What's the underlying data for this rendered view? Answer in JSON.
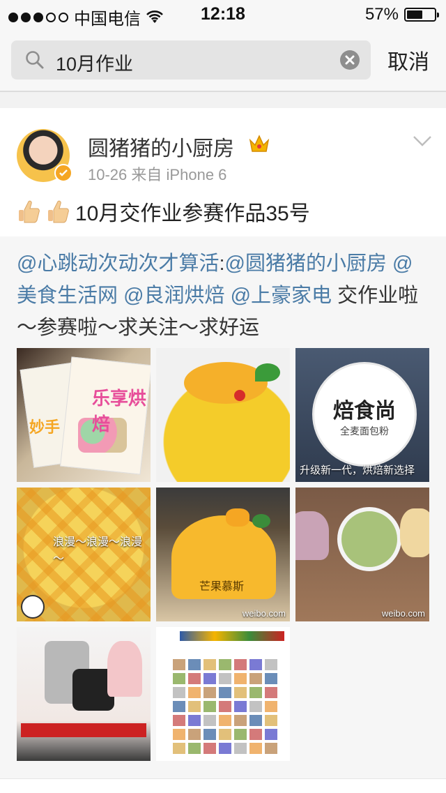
{
  "status_bar": {
    "carrier": "中国电信",
    "time": "12:18",
    "battery_percent": "57%",
    "battery_level": 0.57,
    "signal_bars": 3
  },
  "search": {
    "query": "10月作业",
    "cancel_label": "取消",
    "icons": {
      "search": "search-icon",
      "clear": "clear-icon"
    }
  },
  "post": {
    "username": "圆猪猪的小厨房",
    "time": "10-26",
    "source_prefix": "来自",
    "source": "iPhone 6",
    "text": "10月交作业参赛作品35号",
    "icons": {
      "verified": "verified-badge",
      "crown": "crown-icon",
      "menu": "chevron-down-icon",
      "emoji": "thumbs-up-icon"
    }
  },
  "repost": {
    "mention_1": "@心跳动次动次才算活",
    "colon": ":",
    "mention_2": "@圆猪猪的小厨房",
    "mention_3": "@美食生活网",
    "mention_4": "@良润烘焙",
    "mention_5": "@上豪家电",
    "text_tail": " 交作业啦～参赛啦～求关注～求好运"
  },
  "images": {
    "magazine_title": "乐享烘焙",
    "magazine_small": "妙手",
    "stamp_main": "焙食尚",
    "stamp_sub": "全麦面包粉",
    "stamp_caption": "升级新一代，烘焙新选择",
    "cake_label": "芒果慕斯",
    "handwriting": "浪漫～浪漫～浪漫～",
    "watermark": "weibo.com"
  },
  "colors": {
    "mention": "#4a7ba6",
    "meta": "#999999",
    "badge": "#f5a623"
  }
}
